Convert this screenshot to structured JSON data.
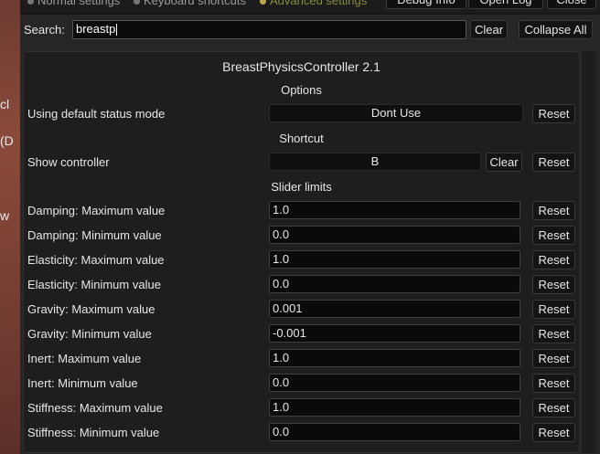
{
  "background_fragments": [
    "cl",
    "(D",
    "w"
  ],
  "top_tabs": [
    "Normal settings",
    "Keyboard shortcuts",
    "Advanced settings"
  ],
  "top_buttons": {
    "debug": "Debug Info",
    "open_log": "Open Log",
    "close": "Close"
  },
  "search": {
    "label": "Search:",
    "value": "breastp",
    "clear": "Clear",
    "collapse": "Collapse All"
  },
  "plugin": {
    "title": "BreastPhysicsController 2.1",
    "options_heading": "Options",
    "status_mode_label": "Using default status mode",
    "status_mode_value": "Dont Use",
    "shortcut_heading": "Shortcut",
    "show_controller_label": "Show controller",
    "show_controller_key": "B",
    "clear_label": "Clear",
    "reset_label": "Reset",
    "slider_heading": "Slider limits",
    "sliders": [
      {
        "label": "Damping: Maximum value",
        "value": "1.0"
      },
      {
        "label": "Damping: Minimum value",
        "value": "0.0"
      },
      {
        "label": "Elasticity: Maximum value",
        "value": "1.0"
      },
      {
        "label": "Elasticity: Minimum value",
        "value": "0.0"
      },
      {
        "label": "Gravity: Maximum value",
        "value": "0.001"
      },
      {
        "label": "Gravity: Minimum value",
        "value": "-0.001"
      },
      {
        "label": "Inert: Maximum value",
        "value": "1.0"
      },
      {
        "label": "Inert: Minimum value",
        "value": "0.0"
      },
      {
        "label": "Stiffness: Maximum value",
        "value": "1.0"
      },
      {
        "label": "Stiffness: Minimum value",
        "value": "0.0"
      }
    ]
  }
}
